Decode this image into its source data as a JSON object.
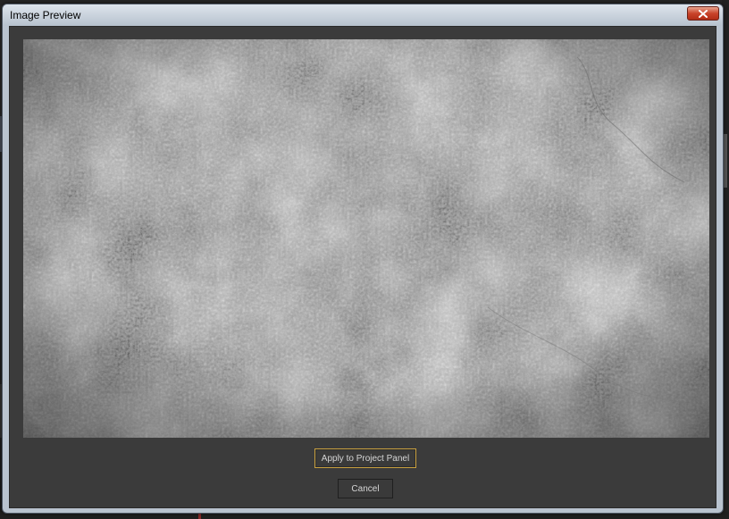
{
  "window": {
    "title": "Image Preview",
    "close_icon": "close-icon",
    "close_color": "#c9442a"
  },
  "preview": {
    "image_description_icon": "stone-texture-image"
  },
  "buttons": {
    "apply_label": "Apply to Project Panel",
    "cancel_label": "Cancel",
    "apply_border_color": "#c8a040"
  },
  "colors": {
    "client_background": "#3b3b3b",
    "titlebar": "#c6d0da"
  }
}
